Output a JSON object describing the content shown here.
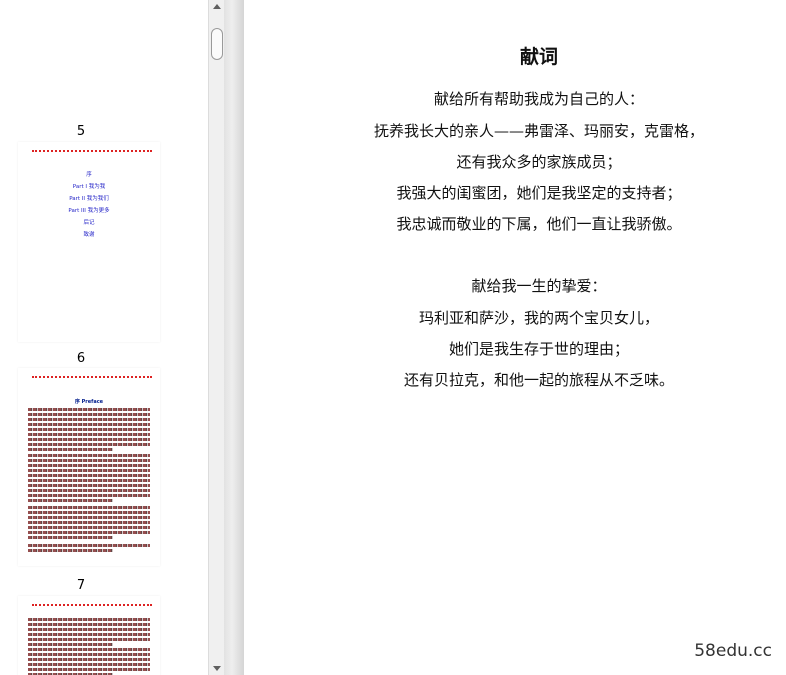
{
  "thumbnails": {
    "page5": {
      "number": "5",
      "toc": [
        "序",
        "Part I 我为我",
        "Part II 我为我们",
        "Part III 我为更多",
        "后记",
        "致谢"
      ]
    },
    "page6": {
      "number": "6",
      "heading": "序 Preface"
    },
    "page7": {
      "number": "7"
    }
  },
  "main": {
    "title": "献词",
    "lines": [
      "献给所有帮助我成为自己的人：",
      "抚养我长大的亲人——弗雷泽、玛丽安，克雷格，",
      "还有我众多的家族成员；",
      "我强大的闺蜜团，她们是我坚定的支持者；",
      "我忠诚而敬业的下属，他们一直让我骄傲。",
      "献给我一生的挚爱：",
      "玛利亚和萨沙，我的两个宝贝女儿，",
      "她们是我生存于世的理由；",
      "还有贝拉克，和他一起的旅程从不乏味。"
    ]
  },
  "watermark": "58edu.cc"
}
